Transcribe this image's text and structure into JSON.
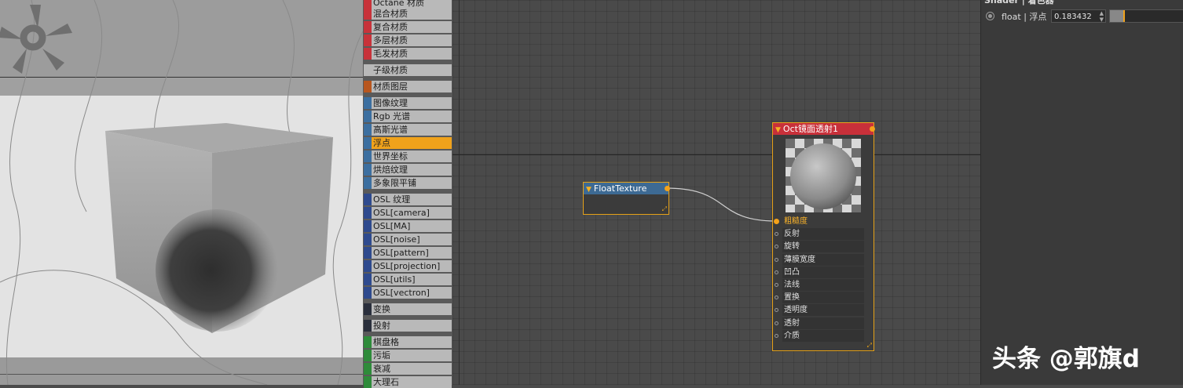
{
  "materials": [
    {
      "label": "Octane 材质",
      "color": "#c8323a"
    },
    {
      "label": "混合材质",
      "color": "#c8323a"
    },
    {
      "label": "复合材质",
      "color": "#c8323a"
    },
    {
      "label": "多层材质",
      "color": "#c8323a"
    },
    {
      "label": "毛发材质",
      "color": "#c8323a"
    },
    {
      "label": "子级材质",
      "color": "#b9b9b9"
    },
    {
      "label": "材质图层",
      "color": "#b8561e"
    },
    {
      "label": "图像纹理",
      "color": "#3c6fa0"
    },
    {
      "label": "Rgb 光谱",
      "color": "#3c6fa0"
    },
    {
      "label": "高斯光谱",
      "color": "#3c6fa0"
    },
    {
      "label": "浮点",
      "color": "#3c6fa0"
    },
    {
      "label": "世界坐标",
      "color": "#3c6fa0"
    },
    {
      "label": "烘焙纹理",
      "color": "#3c6fa0"
    },
    {
      "label": "多象限平铺",
      "color": "#3c6fa0"
    },
    {
      "label": "OSL 纹理",
      "color": "#2e4a8e"
    },
    {
      "label": "OSL[camera]",
      "color": "#2e4a8e"
    },
    {
      "label": "OSL[MA]",
      "color": "#2e4a8e"
    },
    {
      "label": "OSL[noise]",
      "color": "#2e4a8e"
    },
    {
      "label": "OSL[pattern]",
      "color": "#2e4a8e"
    },
    {
      "label": "OSL[projection]",
      "color": "#2e4a8e"
    },
    {
      "label": "OSL[utils]",
      "color": "#2e4a8e"
    },
    {
      "label": "OSL[vectron]",
      "color": "#2e4a8e"
    },
    {
      "label": "变换",
      "color": "#2a2f3c"
    },
    {
      "label": "投射",
      "color": "#2a2f3c"
    },
    {
      "label": "棋盘格",
      "color": "#2e8b3a"
    },
    {
      "label": "污垢",
      "color": "#2e8b3a"
    },
    {
      "label": "衰减",
      "color": "#2e8b3a"
    },
    {
      "label": "大理石",
      "color": "#2e8b3a"
    }
  ],
  "selected_material": "浮点",
  "float_node": {
    "title": "FloatTexture",
    "header_color": "#3d6a94"
  },
  "oct_node": {
    "title": "Oct镜面透射1",
    "header_color": "#c8303a",
    "sockets": [
      {
        "label": "粗糙度",
        "connected": true
      },
      {
        "label": "反射",
        "connected": false
      },
      {
        "label": "旋转",
        "connected": false
      },
      {
        "label": "薄膜宽度",
        "connected": false
      },
      {
        "label": "凹凸",
        "connected": false
      },
      {
        "label": "法线",
        "connected": false
      },
      {
        "label": "置换",
        "connected": false
      },
      {
        "label": "透明度",
        "connected": false
      },
      {
        "label": "透射",
        "connected": false
      },
      {
        "label": "介质",
        "connected": false
      }
    ]
  },
  "properties": {
    "title": "Shader | 着色器",
    "param_label": "float | 浮点",
    "value": "0.183432",
    "slider_fraction": 0.183
  },
  "watermark": "头条 @郭旗d",
  "colors": {
    "accent": "#f0a21b",
    "arrow": "#e8231e"
  }
}
